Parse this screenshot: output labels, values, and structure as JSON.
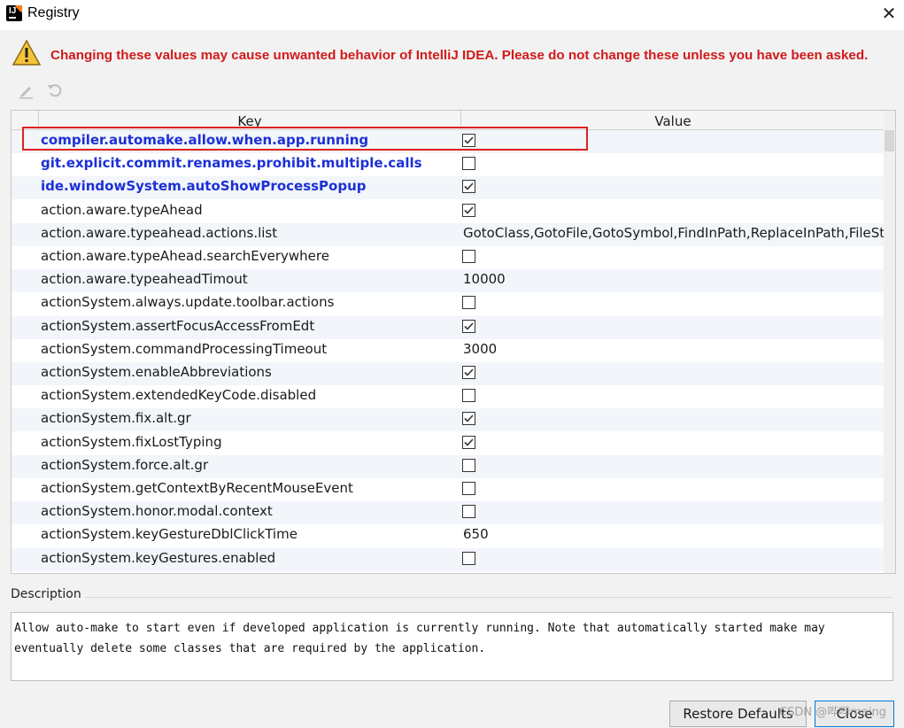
{
  "window": {
    "title": "Registry"
  },
  "warning": {
    "text": "Changing these values may cause unwanted behavior of IntelliJ IDEA. Please do not change these unless you have been asked."
  },
  "toolbar": {
    "edit_icon": "pencil-icon",
    "revert_icon": "undo-icon"
  },
  "table": {
    "columns": [
      "Key",
      "Value"
    ],
    "rows": [
      {
        "key": "compiler.automake.allow.when.app.running",
        "type": "bool",
        "checked": true,
        "modified": true
      },
      {
        "key": "git.explicit.commit.renames.prohibit.multiple.calls",
        "type": "bool",
        "checked": false,
        "modified": true
      },
      {
        "key": "ide.windowSystem.autoShowProcessPopup",
        "type": "bool",
        "checked": true,
        "modified": true
      },
      {
        "key": "action.aware.typeAhead",
        "type": "bool",
        "checked": true,
        "modified": false
      },
      {
        "key": "action.aware.typeahead.actions.list",
        "type": "text",
        "value": "GotoClass,GotoFile,GotoSymbol,FindInPath,ReplaceInPath,FileStru",
        "modified": false
      },
      {
        "key": "action.aware.typeAhead.searchEverywhere",
        "type": "bool",
        "checked": false,
        "modified": false
      },
      {
        "key": "action.aware.typeaheadTimout",
        "type": "text",
        "value": "10000",
        "modified": false
      },
      {
        "key": "actionSystem.always.update.toolbar.actions",
        "type": "bool",
        "checked": false,
        "modified": false
      },
      {
        "key": "actionSystem.assertFocusAccessFromEdt",
        "type": "bool",
        "checked": true,
        "modified": false
      },
      {
        "key": "actionSystem.commandProcessingTimeout",
        "type": "text",
        "value": "3000",
        "modified": false
      },
      {
        "key": "actionSystem.enableAbbreviations",
        "type": "bool",
        "checked": true,
        "modified": false
      },
      {
        "key": "actionSystem.extendedKeyCode.disabled",
        "type": "bool",
        "checked": false,
        "modified": false
      },
      {
        "key": "actionSystem.fix.alt.gr",
        "type": "bool",
        "checked": true,
        "modified": false
      },
      {
        "key": "actionSystem.fixLostTyping",
        "type": "bool",
        "checked": true,
        "modified": false
      },
      {
        "key": "actionSystem.force.alt.gr",
        "type": "bool",
        "checked": false,
        "modified": false
      },
      {
        "key": "actionSystem.getContextByRecentMouseEvent",
        "type": "bool",
        "checked": false,
        "modified": false
      },
      {
        "key": "actionSystem.honor.modal.context",
        "type": "bool",
        "checked": false,
        "modified": false
      },
      {
        "key": "actionSystem.keyGestureDblClickTime",
        "type": "text",
        "value": "650",
        "modified": false
      },
      {
        "key": "actionSystem.keyGestures.enabled",
        "type": "bool",
        "checked": false,
        "modified": false
      }
    ]
  },
  "description": {
    "label": "Description",
    "line1": "Allow auto-make to start even if developed application is currently running. Note that automatically started make may",
    "line2": "eventually delete some classes that are required by the application."
  },
  "buttons": {
    "restore": "Restore Defaults",
    "close": "Close"
  },
  "watermark": "CSDN @哔哔maing",
  "colors": {
    "warning": "#d11a1a",
    "modified_key": "#1c30d6",
    "highlight_border": "#e02020"
  }
}
